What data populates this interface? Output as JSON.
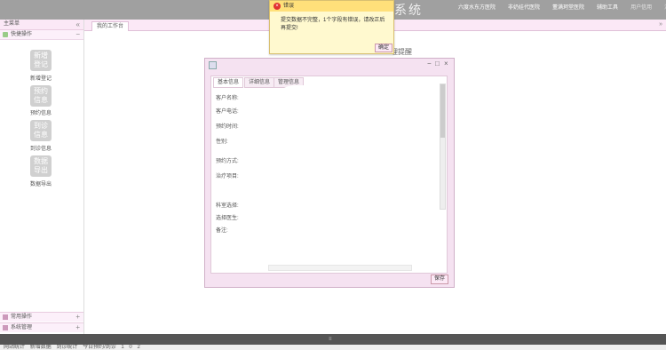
{
  "topbar": {
    "title": "理系统",
    "links": [
      "六度水东方医院",
      "非奶娃代医院",
      "董满珂堂医院",
      "辅助工具",
      "用户信用",
      "消息",
      "退出"
    ]
  },
  "sidebar": {
    "title": "主菜单",
    "collapse": "«",
    "quick_ops": "快捷操作",
    "tiles": [
      {
        "text": "新增\n登记",
        "label": "新增登记"
      },
      {
        "text": "预约\n信息",
        "label": "预约信息"
      },
      {
        "text": "到诊\n信息",
        "label": "到诊信息"
      },
      {
        "text": "数据\n导出",
        "label": "数据导出"
      }
    ],
    "groups": [
      {
        "label": "常用操作"
      },
      {
        "label": "系统管理"
      }
    ]
  },
  "tabs": {
    "workbench": "我的工作台"
  },
  "background_text": "理提醒",
  "dialog": {
    "tabs": [
      "基本信息",
      "详细信息",
      "管理信息"
    ],
    "fields": [
      "客户名称:",
      "客户电话:",
      "预约时间:",
      "性别:",
      "预约方式:",
      "治疗项目:",
      "科室选择:",
      "选择医生:",
      "备注:"
    ],
    "save": "保存"
  },
  "error": {
    "title": "错误",
    "message": "提交数据不完整，1个字段有错误，请改正后再提交!",
    "ok": "确定"
  },
  "taskbar": [
    "网站统计",
    "新增数据",
    "到诊统计",
    "今日预约/到诊",
    "1",
    "0",
    "2"
  ]
}
